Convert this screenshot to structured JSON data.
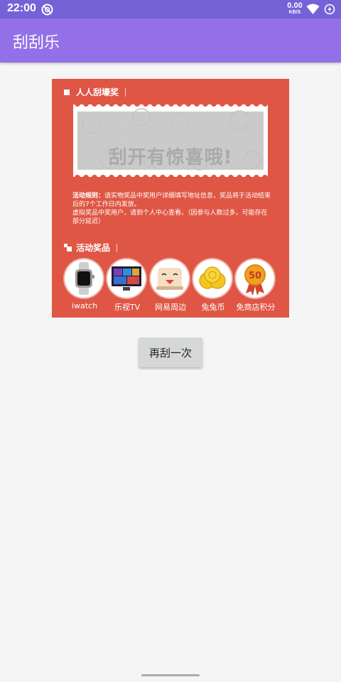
{
  "status_bar": {
    "time": "22:00",
    "net_speed_value": "0.00",
    "net_speed_unit": "KB/S",
    "icons": [
      "app-notification-icon",
      "wifi-icon",
      "battery-charging-icon"
    ]
  },
  "app_bar": {
    "title": "刮刮乐"
  },
  "card": {
    "background_color": "#df5645",
    "scratch_section_title": "人人刮壕奖",
    "scratch_overlay_text": "刮开有惊喜哦!",
    "rules_label": "活动规则：",
    "rules_line1": "请实物奖品中奖用户详细填写地址信息，奖品将于活动结束后的7个工作日内发放。",
    "rules_line2": "虚拟奖品中奖用户，请到个人中心查看。（因参与人数过多，可能存在部分延迟）",
    "prizes_section_title": "活动奖品",
    "prizes": [
      {
        "name": "iwatch",
        "icon": "smartwatch-icon"
      },
      {
        "name": "乐视TV",
        "icon": "tv-icon"
      },
      {
        "name": "网易周边",
        "icon": "netease-mascot-icon"
      },
      {
        "name": "兔兔币",
        "icon": "coins-icon"
      },
      {
        "name": "免商店积分",
        "icon": "points-badge-icon",
        "badge_text": "50"
      }
    ]
  },
  "retry_button": {
    "label": "再刮一次"
  },
  "colors": {
    "status_bar": "#7462d6",
    "app_bar": "#9370e8",
    "card": "#df5645",
    "page_background": "#f5f5f5",
    "button": "#d6d7d7"
  }
}
